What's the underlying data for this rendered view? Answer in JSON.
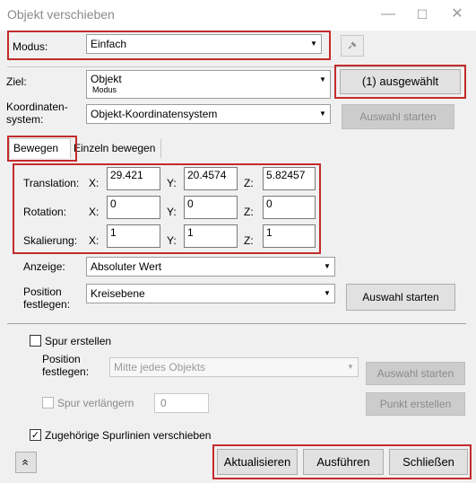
{
  "window": {
    "title": "Objekt verschieben",
    "controls": {
      "minimize": "—",
      "maximize": "☐",
      "close": "✕"
    }
  },
  "modus": {
    "label": "Modus:",
    "value": "Einfach",
    "icon": "pin-icon"
  },
  "ziel": {
    "label": "Ziel:",
    "value": "Objekt",
    "sublabel": "Modus"
  },
  "selected_button": "(1) ausgewählt",
  "koordinatensystem": {
    "label_line1": "Koordinaten-",
    "label_line2": "system:",
    "value": "Objekt-Koordinatensystem"
  },
  "auswahl_starten_1": "Auswahl starten",
  "tabs": [
    {
      "label": "Bewegen"
    },
    {
      "label": "Einzeln bewegen"
    }
  ],
  "transform": {
    "axis_x": "X:",
    "axis_y": "Y:",
    "axis_z": "Z:",
    "rows": [
      {
        "label": "Translation:",
        "x": "29.421",
        "y": "20.4574",
        "z": "5.82457"
      },
      {
        "label": "Rotation:",
        "x": "0",
        "y": "0",
        "z": "0"
      },
      {
        "label": "Skalierung:",
        "x": "1",
        "y": "1",
        "z": "1"
      }
    ]
  },
  "anzeige": {
    "label": "Anzeige:",
    "value": "Absoluter Wert"
  },
  "position": {
    "label_line1": "Position",
    "label_line2": "festlegen:",
    "value": "Kreisebene"
  },
  "auswahl_starten_2": "Auswahl starten",
  "spur": {
    "checkbox_label": "Spur erstellen",
    "position_label_line1": "Position",
    "position_label_line2": "festlegen:",
    "position_value": "Mitte jedes Objekts",
    "auswahl_starten": "Auswahl starten",
    "verlaengern_label": "Spur verlängern",
    "verlaengern_value": "0",
    "punkt_erstellen": "Punkt erstellen"
  },
  "spurlinien": {
    "label": "Zugehörige Spurlinien verschieben",
    "checked": true,
    "checkmark": "✓"
  },
  "footer": {
    "collapse_icon": "«",
    "aktualisieren": "Aktualisieren",
    "ausfuehren": "Ausführen",
    "schliessen": "Schließen"
  },
  "colors": {
    "highlight": "#c42b2b",
    "dialog_bg": "#f0f0f0",
    "disabled_text": "#8a8a8a"
  }
}
